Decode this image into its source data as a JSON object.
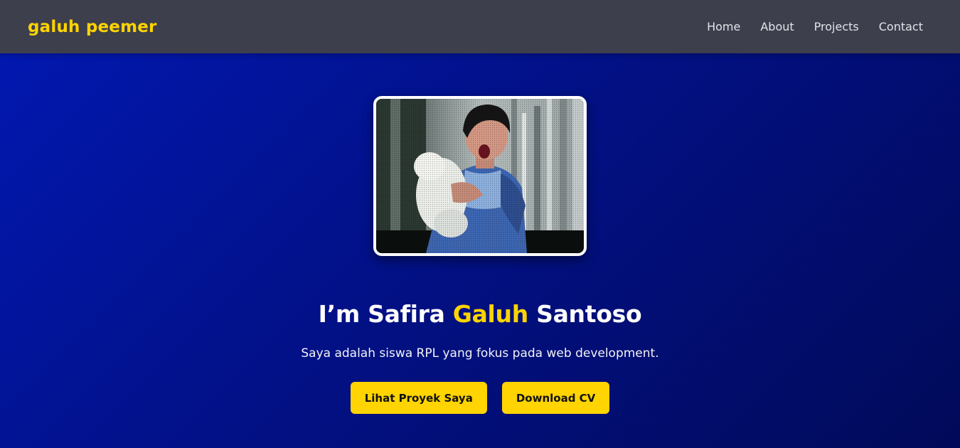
{
  "navbar": {
    "brand": "galuh peemer",
    "links": [
      {
        "label": "Home"
      },
      {
        "label": "About"
      },
      {
        "label": "Projects"
      },
      {
        "label": "Contact"
      }
    ]
  },
  "hero": {
    "title_prefix": "I’m Safira ",
    "title_highlight": "Galuh",
    "title_suffix": " Santoso",
    "subtitle": "Saya adalah siswa RPL yang fokus pada web development.",
    "buttons": [
      {
        "label": "Lihat Proyek Saya"
      },
      {
        "label": "Download CV"
      }
    ]
  },
  "colors": {
    "accent": "#ffd400",
    "navbar_bg": "#3d3f4d",
    "hero_gradient_start": "#0218b3",
    "hero_gradient_end": "#010a59"
  }
}
